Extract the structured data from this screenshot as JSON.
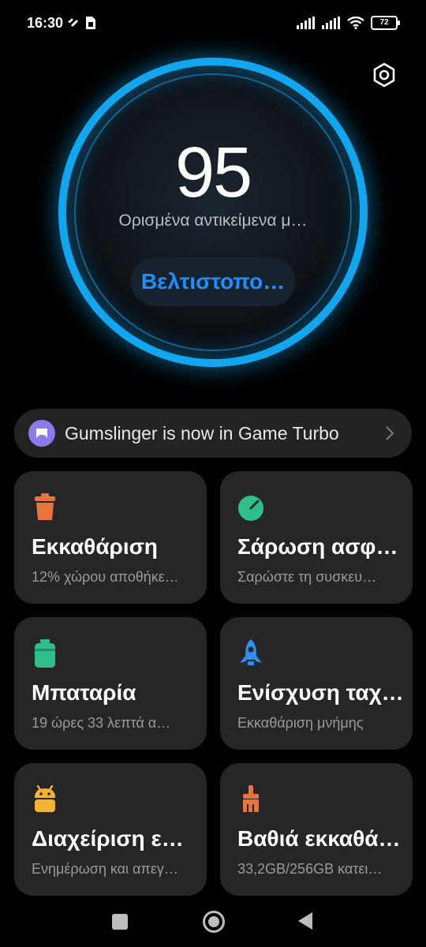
{
  "status_bar": {
    "time": "16:30",
    "battery": "72"
  },
  "score": {
    "value": "95",
    "message": "Ορισμένα αντικείμενα μ…",
    "optimize_label": "Βελτιστοπο…",
    "ring_color": "#12a6ef"
  },
  "banner": {
    "text": "Gumslinger is now in Game Turbo",
    "icon": "game-controller-icon"
  },
  "cards": [
    {
      "icon": "trash-can-icon",
      "icon_color": "#e8743b",
      "title": "Εκκαθάριση",
      "subtitle": "12% χώρου αποθήκε…"
    },
    {
      "icon": "security-scan-icon",
      "icon_color": "#2fbf8a",
      "title": "Σάρωση ασφα…",
      "subtitle": "Σαρώστε τη συσκευ…"
    },
    {
      "icon": "battery-icon",
      "icon_color": "#2fbf8a",
      "title": "Μπαταρία",
      "subtitle": "19 ώρες 33 λεπτά  α…"
    },
    {
      "icon": "rocket-icon",
      "icon_color": "#2e8df0",
      "title": "Ενίσχυση ταχ…",
      "subtitle": "Εκκαθάριση μνήμης"
    },
    {
      "icon": "android-icon",
      "icon_color": "#f2b531",
      "title": "Διαχείριση ε…",
      "subtitle": "Ενημέρωση και απεγ…"
    },
    {
      "icon": "broom-icon",
      "icon_color": "#e8743b",
      "title": "Βαθιά εκκαθά…",
      "subtitle": "33,2GB/256GB κατει…"
    }
  ]
}
